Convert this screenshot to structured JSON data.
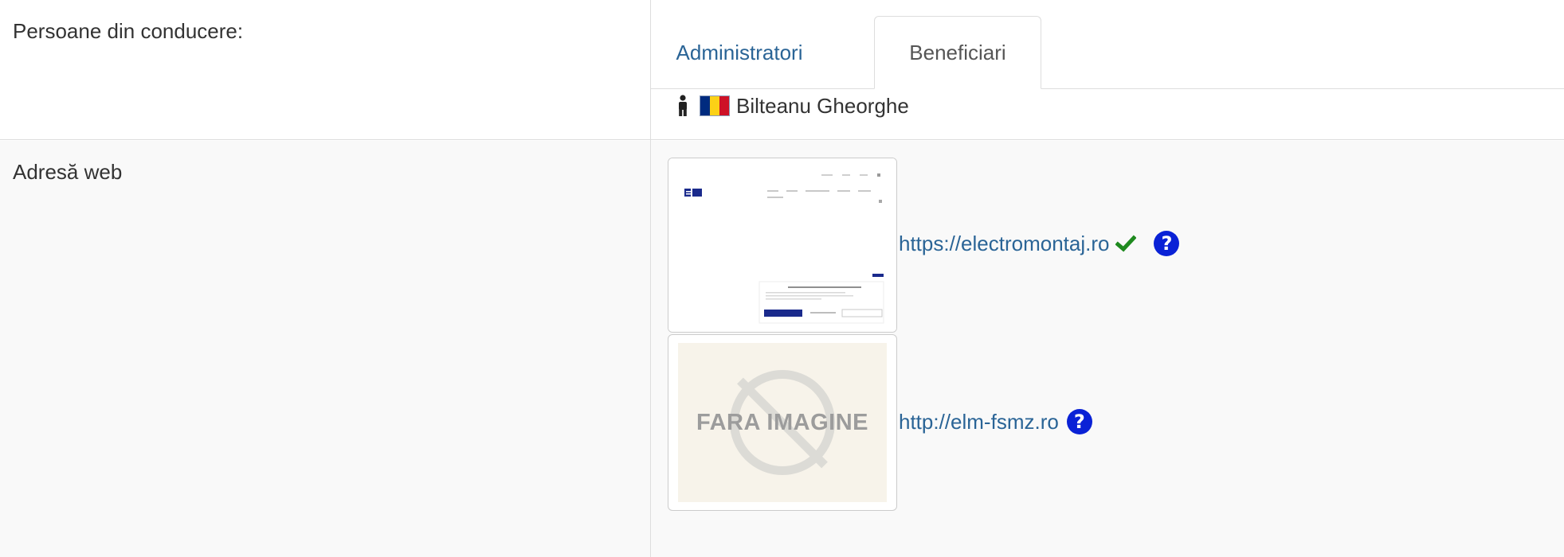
{
  "management": {
    "label": "Persoane din conducere:",
    "tabs": [
      {
        "label": "Administratori",
        "active": false
      },
      {
        "label": "Beneficiari",
        "active": true
      }
    ],
    "person": {
      "icon": "person-icon",
      "flag": "romania-flag-icon",
      "name": "Bilteanu Gheorghe"
    }
  },
  "web": {
    "label": "Adresă web",
    "entries": [
      {
        "url": "https://electromontaj.ro",
        "verified": true,
        "thumbnail": "site-preview",
        "help_icon": "question-circle-icon"
      },
      {
        "url": "http://elm-fsmz.ro",
        "verified": false,
        "thumbnail": "no-image-placeholder",
        "no_image_text": "FARA IMAGINE",
        "help_icon": "question-circle-icon"
      }
    ]
  },
  "colors": {
    "link": "#2a6496",
    "check": "#1f8a1f",
    "help": "#0a22d6",
    "row_alt": "#f9f9f9",
    "border": "#dddddd"
  }
}
